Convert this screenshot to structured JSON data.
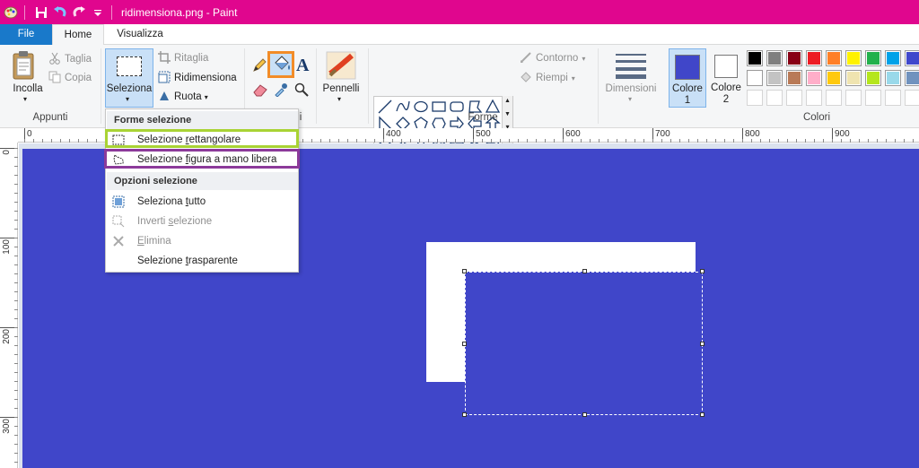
{
  "window": {
    "title": "ridimensiona.png - Paint"
  },
  "tabs": {
    "file": "File",
    "home": "Home",
    "view": "Visualizza"
  },
  "clipboard": {
    "paste": "Incolla",
    "cut": "Taglia",
    "copy": "Copia",
    "group": "Appunti"
  },
  "image": {
    "select": "Seleziona",
    "crop": "Ritaglia",
    "resize": "Ridimensiona",
    "rotate": "Ruota"
  },
  "tools": {
    "brushes": "Pennelli",
    "group_partial": "i"
  },
  "shapes": {
    "outline": "Contorno",
    "fill": "Riempi",
    "group": "Forme"
  },
  "size": {
    "label": "Dimensioni"
  },
  "colors": {
    "color1_label": "Colore",
    "color1_num": "1",
    "color2_label": "Colore",
    "color2_num": "2",
    "group": "Colori",
    "color1_value": "#4046c9",
    "color2_value": "#ffffff",
    "palette": [
      "#000000",
      "#7f7f7f",
      "#880015",
      "#ed1c24",
      "#ff7f27",
      "#fff200",
      "#22b14c",
      "#00a2e8",
      "#3f48cc",
      "#ffffff",
      "#c3c3c3",
      "#b97a57",
      "#ffaec9",
      "#ffc90e",
      "#efe4b0",
      "#b5e61d",
      "#99d9ea",
      "#7092be"
    ]
  },
  "ruler": {
    "h_ticks": [
      "0",
      "400",
      "500",
      "600",
      "700",
      "800",
      "900"
    ],
    "v_ticks": [
      "0",
      "100",
      "200",
      "300"
    ]
  },
  "menu": {
    "section1": "Forme selezione",
    "rect_select_pre": "Selezione ",
    "rect_select_key": "r",
    "rect_select_post": "ettangolare",
    "free_select_pre": "Selezione ",
    "free_select_key": "f",
    "free_select_post": "igura a mano libera",
    "section2": "Opzioni selezione",
    "select_all_pre": "Seleziona ",
    "select_all_key": "t",
    "select_all_post": "utto",
    "invert_pre": "Inverti ",
    "invert_key": "s",
    "invert_post": "elezione",
    "delete_pre": "",
    "delete_key": "E",
    "delete_post": "limina",
    "transparent_pre": "Selezione ",
    "transparent_key": "t",
    "transparent_post": "rasparente"
  }
}
